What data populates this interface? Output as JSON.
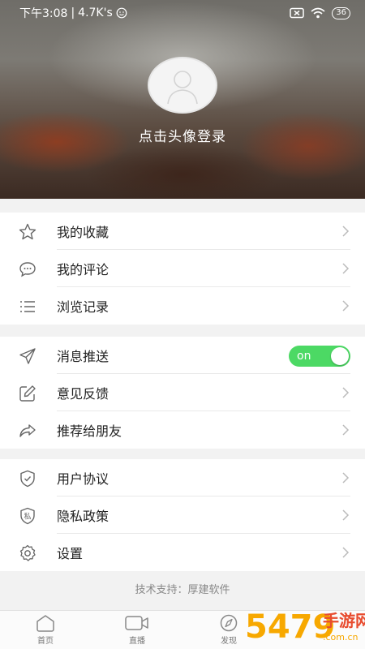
{
  "status_bar": {
    "time": "下午3:08",
    "separator": "|",
    "speed": "4.7K's",
    "battery": "36"
  },
  "header": {
    "login_text": "点击头像登录"
  },
  "menu": {
    "group1": [
      {
        "label": "我的收藏",
        "icon": "star-icon"
      },
      {
        "label": "我的评论",
        "icon": "comment-icon"
      },
      {
        "label": "浏览记录",
        "icon": "list-icon"
      }
    ],
    "group2": [
      {
        "label": "消息推送",
        "icon": "send-icon",
        "toggle": "on"
      },
      {
        "label": "意见反馈",
        "icon": "edit-icon"
      },
      {
        "label": "推荐给朋友",
        "icon": "share-icon"
      }
    ],
    "group3": [
      {
        "label": "用户协议",
        "icon": "shield-icon"
      },
      {
        "label": "隐私政策",
        "icon": "privacy-icon",
        "icon_text": "私"
      },
      {
        "label": "设置",
        "icon": "gear-icon"
      }
    ]
  },
  "footer": {
    "tech_support": "技术支持：厚建软件"
  },
  "bottom_nav": [
    {
      "label": "首页",
      "icon": "home-icon"
    },
    {
      "label": "直播",
      "icon": "video-icon"
    },
    {
      "label": "发现",
      "icon": "compass-icon"
    }
  ],
  "watermark": {
    "text": "手游网",
    "number": "5479",
    "domain": ".com.cn"
  },
  "colors": {
    "toggle_on": "#4cd964",
    "watermark": "#f7a800"
  }
}
